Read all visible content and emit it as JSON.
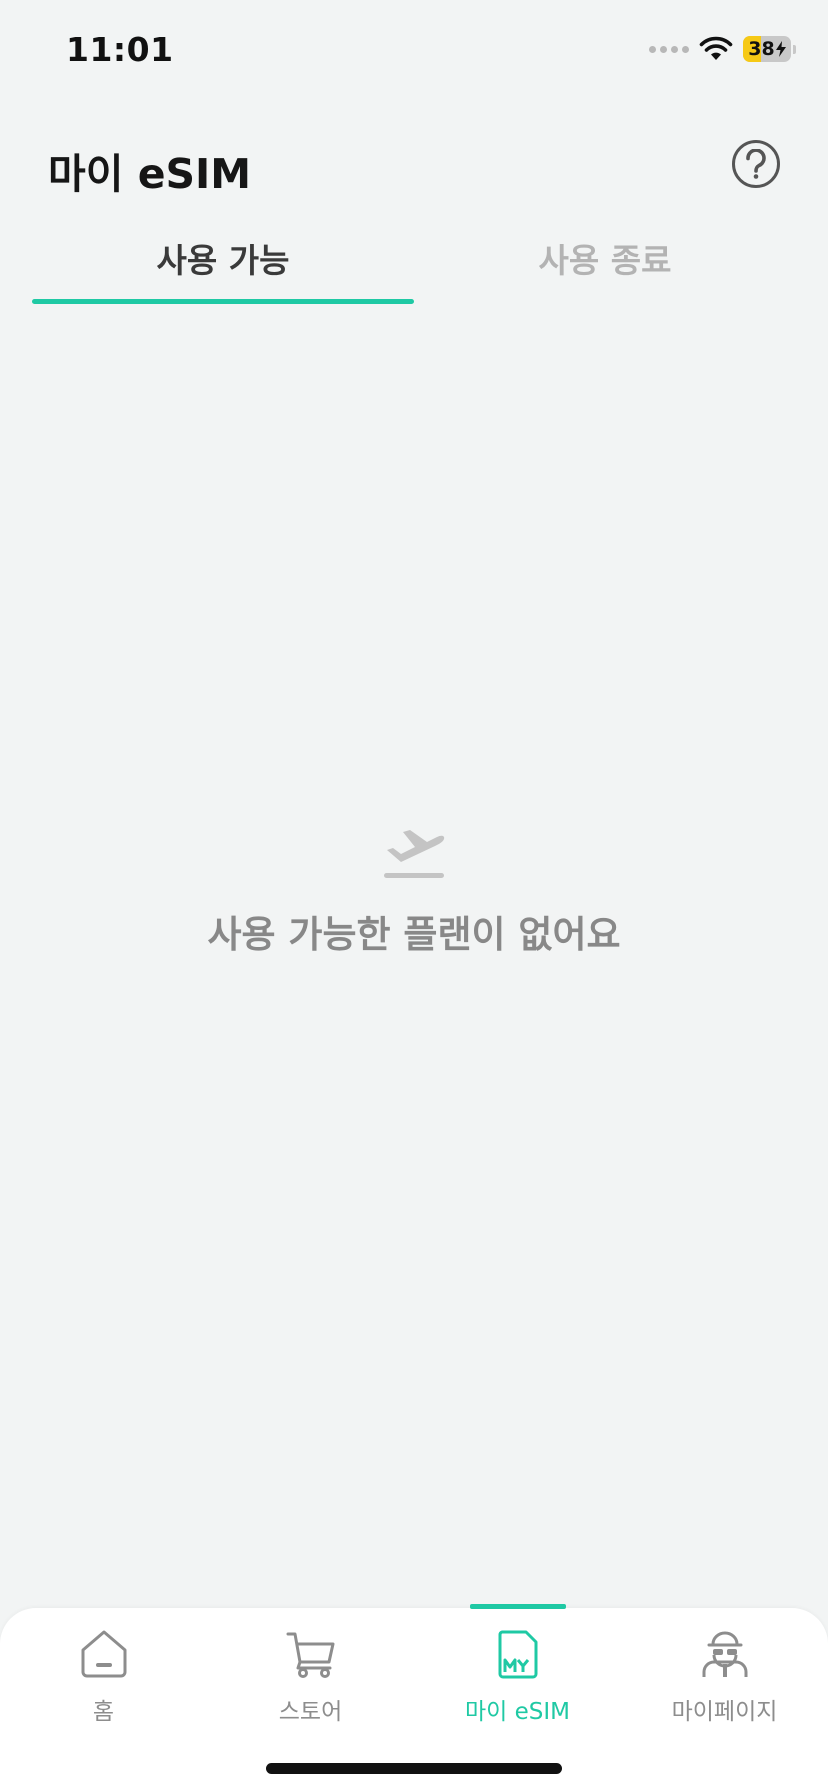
{
  "status_bar": {
    "time": "11:01",
    "battery_level": "38",
    "battery_fraction": 0.38,
    "icons": [
      "signal-icon",
      "wifi-icon",
      "battery-charging-icon"
    ]
  },
  "header": {
    "title": "마이 eSIM",
    "help_icon": "question-circle-icon"
  },
  "tabs": [
    {
      "label": "사용 가능",
      "active": true
    },
    {
      "label": "사용 종료",
      "active": false
    }
  ],
  "empty_state": {
    "icon": "plane-takeoff-icon",
    "message": "사용 가능한 플랜이 없어요"
  },
  "bottom_nav": {
    "items": [
      {
        "label": "홈",
        "icon": "home-icon",
        "active": false
      },
      {
        "label": "스토어",
        "icon": "cart-icon",
        "active": false
      },
      {
        "label": "마이 eSIM",
        "icon": "my-sim-icon",
        "active": true
      },
      {
        "label": "마이페이지",
        "icon": "profile-icon",
        "active": false
      }
    ]
  },
  "colors": {
    "accent": "#1fc9a4",
    "background": "#f2f4f4",
    "inactive_text": "#8d8d8d",
    "battery": "#f6c915"
  }
}
